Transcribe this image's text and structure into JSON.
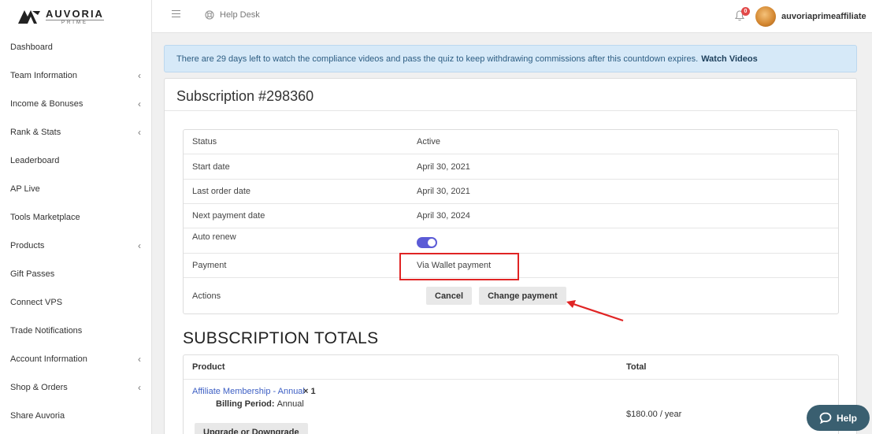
{
  "brand": {
    "name": "AUVORIA",
    "sub": "PRIME"
  },
  "sidebar": {
    "items": [
      {
        "label": "Dashboard",
        "chevron": ""
      },
      {
        "label": "Team Information",
        "chevron": "‹"
      },
      {
        "label": "Income & Bonuses",
        "chevron": "‹"
      },
      {
        "label": "Rank & Stats",
        "chevron": "‹"
      },
      {
        "label": "Leaderboard",
        "chevron": ""
      },
      {
        "label": "AP Live",
        "chevron": ""
      },
      {
        "label": "Tools Marketplace",
        "chevron": ""
      },
      {
        "label": "Products",
        "chevron": "‹"
      },
      {
        "label": "Gift Passes",
        "chevron": ""
      },
      {
        "label": "Connect VPS",
        "chevron": ""
      },
      {
        "label": "Trade Notifications",
        "chevron": ""
      },
      {
        "label": "Account Information",
        "chevron": "‹"
      },
      {
        "label": "Shop & Orders",
        "chevron": "‹"
      },
      {
        "label": "Share Auvoria",
        "chevron": ""
      }
    ]
  },
  "topbar": {
    "help_desk": "Help Desk",
    "notification_count": "0",
    "username": "auvoriaprimeaffiliate"
  },
  "alert": {
    "text": "There are 29 days left to watch the compliance videos and pass the quiz to keep withdrawing commissions after this countdown expires.",
    "link": "Watch Videos"
  },
  "subscription": {
    "title": "Subscription #298360",
    "rows": {
      "status": {
        "label": "Status",
        "value": "Active"
      },
      "start_date": {
        "label": "Start date",
        "value": "April 30, 2021"
      },
      "last_order_date": {
        "label": "Last order date",
        "value": "April 30, 2021"
      },
      "next_payment_date": {
        "label": "Next payment date",
        "value": "April 30, 2024"
      },
      "auto_renew": {
        "label": "Auto renew",
        "enabled": true
      },
      "payment": {
        "label": "Payment",
        "value": "Via Wallet payment"
      },
      "actions": {
        "label": "Actions",
        "cancel": "Cancel",
        "change_payment": "Change payment"
      }
    }
  },
  "totals": {
    "title": "SUBSCRIPTION TOTALS",
    "col_product": "Product",
    "col_total": "Total",
    "product_name": "Affiliate Membership - Annual",
    "quantity": "× 1",
    "billing_label": "Billing Period:",
    "billing_value": "Annual",
    "price": "$180.00 / year",
    "upgrade_label": "Upgrade or Downgrade"
  },
  "help_button": {
    "label": "Help"
  },
  "colors": {
    "accent": "#5b5bd6",
    "highlight": "#e02424",
    "alert_bg": "#d6e9f8",
    "link": "#3d5fc4"
  }
}
